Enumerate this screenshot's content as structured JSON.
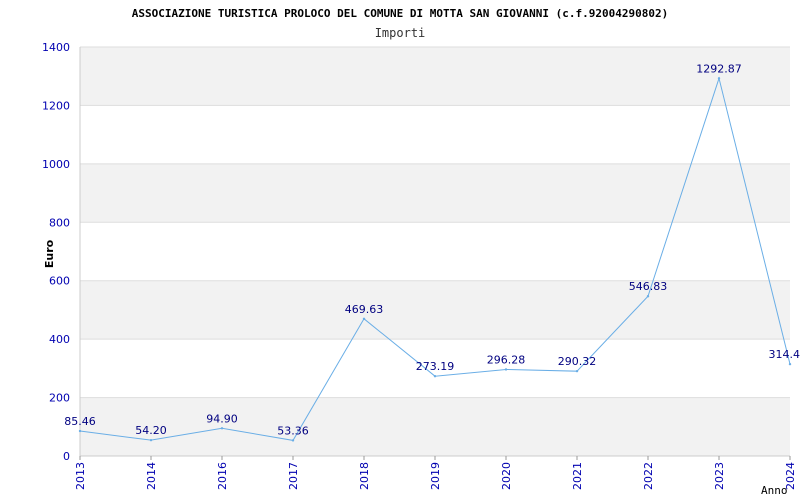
{
  "chart_data": {
    "type": "line",
    "title": "ASSOCIAZIONE TURISTICA PROLOCO DEL COMUNE DI MOTTA SAN GIOVANNI (c.f.92004290802)",
    "subtitle": "Importi",
    "xlabel": "Anno",
    "ylabel": "Euro",
    "categories": [
      "2013",
      "2014",
      "2016",
      "2017",
      "2018",
      "2019",
      "2020",
      "2021",
      "2022",
      "2023",
      "2024"
    ],
    "series": [
      {
        "values": [
          85.46,
          54.2,
          94.9,
          53.36,
          469.63,
          273.19,
          296.28,
          290.32,
          546.83,
          1292.87,
          314.4
        ],
        "labels": [
          "85.46",
          "54.20",
          "94.90",
          "53.36",
          "469.63",
          "273.19",
          "296.28",
          "290.32",
          "546.83",
          "1292.87",
          "314.4"
        ]
      }
    ],
    "ylim": [
      0,
      1400
    ],
    "yticks": [
      0,
      200,
      400,
      600,
      800,
      1000,
      1200,
      1400
    ],
    "grid": true,
    "colors": {
      "line": "#6aaee6",
      "band": "#f2f2f2",
      "axis_text": "#0000b0",
      "label_text": "#000080",
      "title_text": "#000000",
      "grid": "#dddddd"
    }
  }
}
